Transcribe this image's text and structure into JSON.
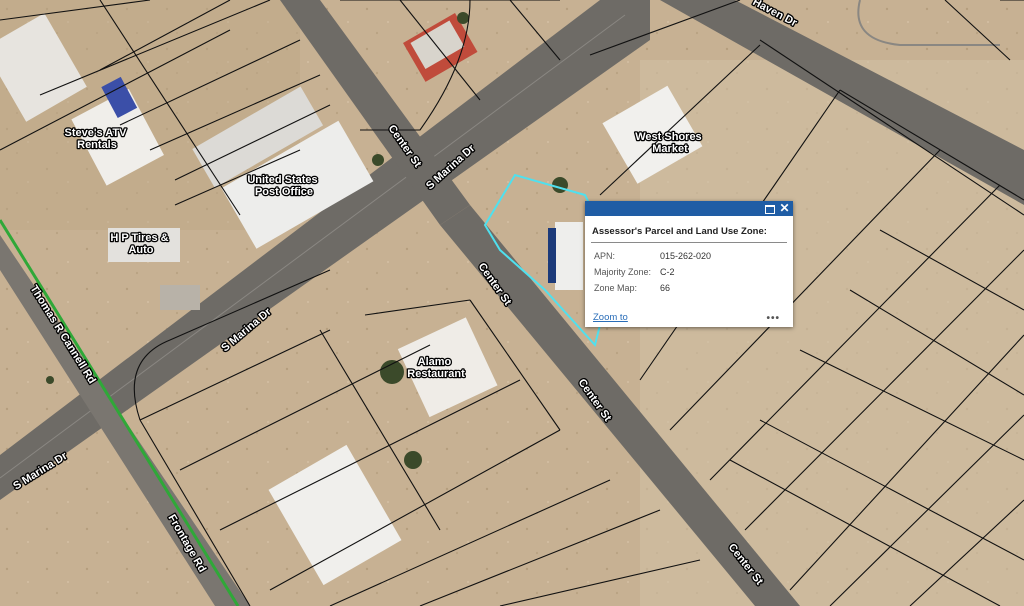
{
  "map_labels": {
    "steves_atv": [
      "Steve's ATV",
      "Rentals"
    ],
    "post_office": [
      "United States",
      "Post Office"
    ],
    "hp_tires": [
      "H P Tires &",
      "Auto"
    ],
    "west_shores": [
      "West Shores",
      "Market"
    ],
    "alamo": [
      "Alamo",
      "Restaurant"
    ]
  },
  "streets": {
    "haven_dr": "Haven Dr",
    "center_st": "Center St",
    "s_marina_dr": "S Marina Dr",
    "thomas_r_cannell_rd": "Thomas R Cannell Rd",
    "frontage_rd": "Frontage Rd"
  },
  "popup": {
    "title": "Assessor's Parcel and Land Use Zone:",
    "rows": [
      {
        "label": "APN:",
        "value": "015-262-020"
      },
      {
        "label": "Majority Zone:",
        "value": "C-2"
      },
      {
        "label": "Zone Map:",
        "value": "66"
      }
    ],
    "zoom_label": "Zoom to",
    "more_label": "•••",
    "close_label": "✕",
    "accent_color": "#1f5da5"
  },
  "colors": {
    "parcel_line": "#111111",
    "selected_parcel": "#4fe0ee",
    "road_green": "#2fa838"
  },
  "icons": [
    "maximize-icon",
    "close-icon",
    "more-icon"
  ]
}
